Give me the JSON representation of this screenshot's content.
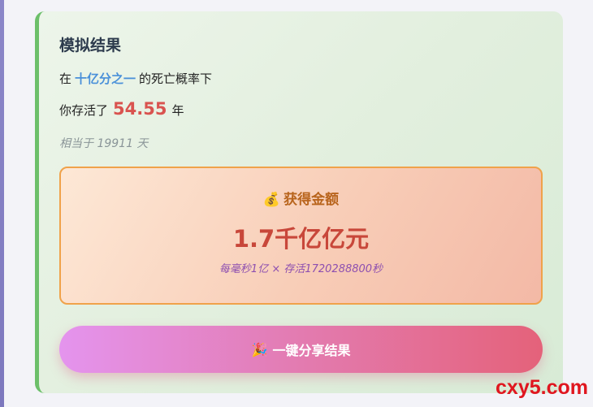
{
  "result": {
    "title": "模拟结果",
    "probability_prefix": "在",
    "probability_value": "十亿分之一",
    "probability_suffix": "的死亡概率下",
    "survived_prefix": "你存活了",
    "survived_years": "54.55",
    "survived_unit": "年",
    "days_text": "相当于 19911 天"
  },
  "amount": {
    "icon": "money-bag-icon",
    "icon_glyph": "💰",
    "title": "获得金额",
    "value": "1.7千亿亿元",
    "formula": "每毫秒1亿 × 存活1720288800秒"
  },
  "share": {
    "icon": "party-popper-icon",
    "icon_glyph": "🎉",
    "label": "一键分享结果"
  },
  "watermark": "cxy5.com",
  "colors": {
    "accent_green": "#6cbf6a",
    "highlight_blue": "#4a90d9",
    "highlight_red": "#d9534f",
    "amount_border": "#f0a24a",
    "amount_text": "#c8473a",
    "formula_purple": "#8d4fb0",
    "watermark_red": "#e0161f"
  }
}
